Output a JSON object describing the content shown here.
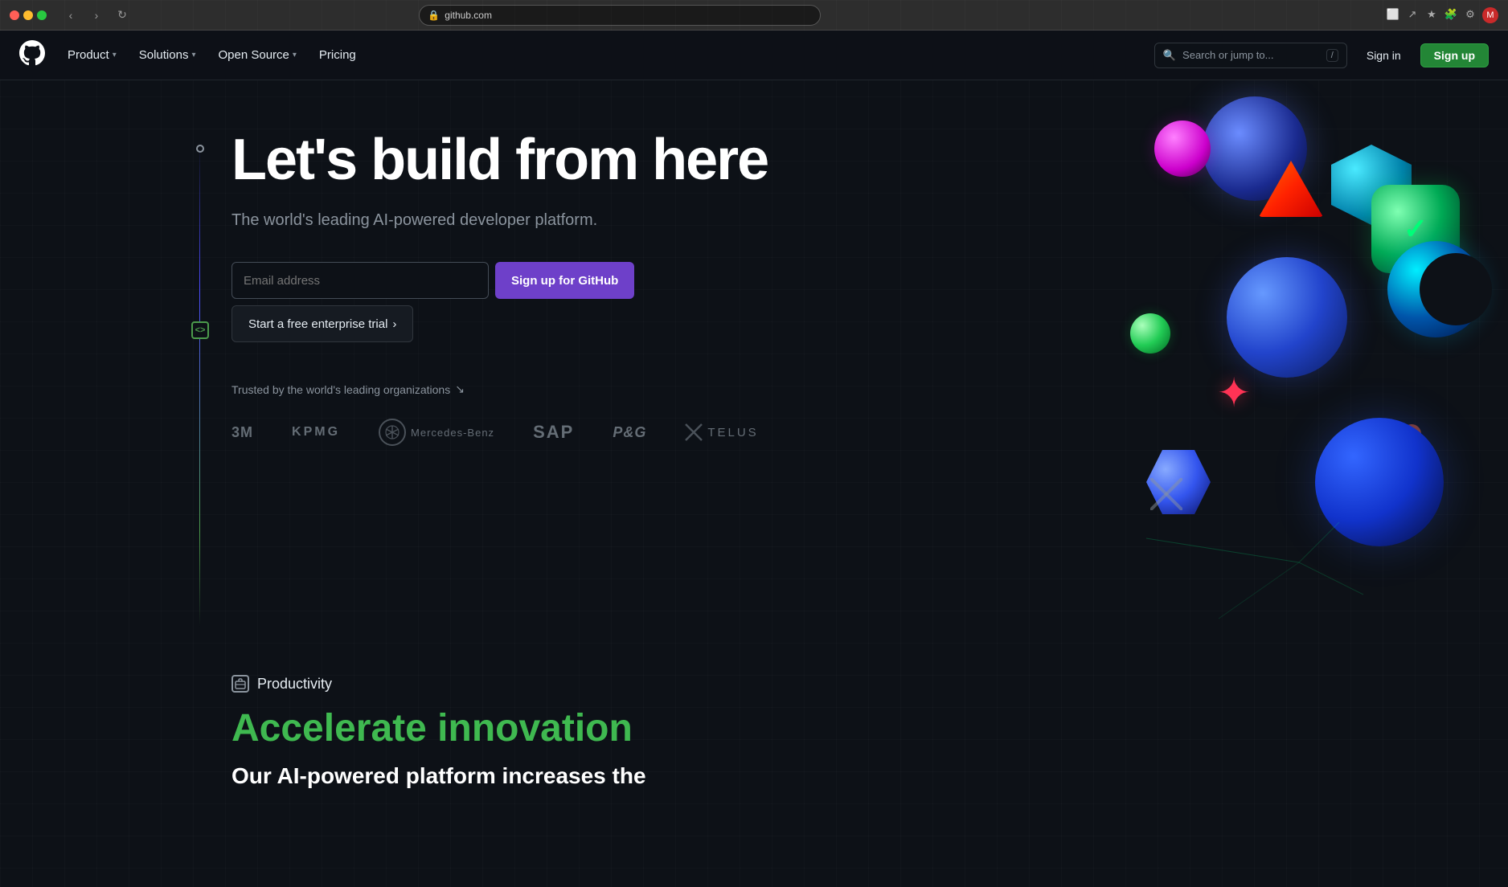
{
  "browser": {
    "url": "github.com",
    "back_btn": "‹",
    "forward_btn": "›",
    "refresh_btn": "↻"
  },
  "navbar": {
    "logo_alt": "GitHub",
    "nav_items": [
      {
        "label": "Product",
        "has_dropdown": true
      },
      {
        "label": "Solutions",
        "has_dropdown": true
      },
      {
        "label": "Open Source",
        "has_dropdown": true
      },
      {
        "label": "Pricing",
        "has_dropdown": false
      }
    ],
    "search_placeholder": "Search or jump to...",
    "search_shortcut": "/",
    "signin_label": "Sign in",
    "signup_label": "Sign up"
  },
  "hero": {
    "title": "Let's build from here",
    "subtitle": "The world's leading AI-powered developer platform.",
    "email_placeholder": "Email address",
    "signup_btn": "Sign up for GitHub",
    "enterprise_btn": "Start a free enterprise trial",
    "enterprise_arrow": "›"
  },
  "trusted": {
    "label": "Trusted by the world's leading organizations",
    "arrow": "↘",
    "companies": [
      {
        "name": "3M",
        "style": "block"
      },
      {
        "name": "KPMG",
        "style": "block"
      },
      {
        "name": "Mercedes-Benz",
        "style": "mercedes"
      },
      {
        "name": "SAP",
        "style": "block"
      },
      {
        "name": "P&G",
        "style": "block"
      },
      {
        "name": "TELUS",
        "style": "telus"
      }
    ]
  },
  "productivity": {
    "section_label": "Productivity",
    "heading": "Accelerate innovation",
    "subtext": "Our AI-powered platform increases the"
  }
}
